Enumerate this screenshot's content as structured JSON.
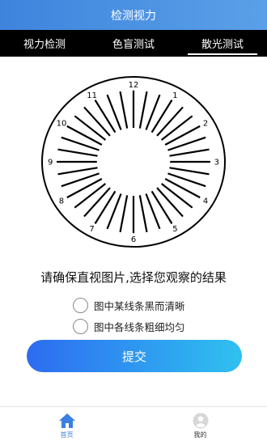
{
  "header": {
    "title": "检测视力"
  },
  "tabs": [
    {
      "label": "视力检测"
    },
    {
      "label": "色盲测试"
    },
    {
      "label": "散光测试"
    }
  ],
  "dial": {
    "labels": [
      "12",
      "1",
      "2",
      "3",
      "4",
      "5",
      "6",
      "7",
      "8",
      "9",
      "10",
      "11"
    ]
  },
  "prompt": {
    "text": "请确保直视图片,选择您观察的结果"
  },
  "options": [
    {
      "label": "图中某线条黑而清晰"
    },
    {
      "label": "图中各线条粗细均匀"
    }
  ],
  "submit": {
    "label": "提交"
  },
  "bottom_nav": [
    {
      "label": "首页",
      "icon": "home-icon",
      "color": "#3b7fe0"
    },
    {
      "label": "我的",
      "icon": "user-icon"
    }
  ]
}
